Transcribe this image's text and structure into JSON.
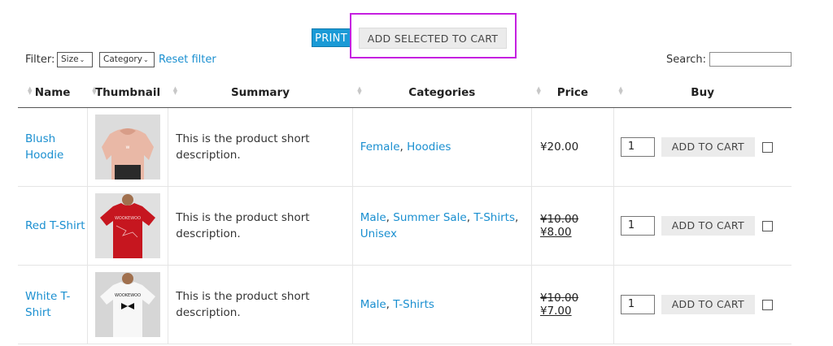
{
  "toolbar": {
    "print_label": "PRINT",
    "add_selected_label": "ADD SELECTED TO CART"
  },
  "filters": {
    "label": "Filter:",
    "size_select": "Size",
    "category_select": "Category",
    "reset_label": "Reset filter",
    "search_label": "Search:",
    "search_value": ""
  },
  "table": {
    "headers": [
      "Name",
      "Thumbnail",
      "Summary",
      "Categories",
      "Price",
      "Buy"
    ],
    "rows": [
      {
        "name_line1": "Blush",
        "name_line2": "Hoodie",
        "summary_line1": "This is the product short",
        "summary_line2": "description.",
        "categories": [
          "Female",
          "Hoodies"
        ],
        "price": "¥20.00",
        "qty": "1",
        "cart_label": "ADD TO CART",
        "thumb_color": "#e9b8a6"
      },
      {
        "name_line1": "Red T-Shirt",
        "name_line2": "",
        "summary_line1": "This is the product short",
        "summary_line2": "description.",
        "categories": [
          "Male",
          "Summer Sale",
          "T-Shirts",
          "Unisex"
        ],
        "price_old": "¥10.00",
        "price_new": "¥8.00",
        "qty": "1",
        "cart_label": "ADD TO CART",
        "thumb_color": "#c6161f"
      },
      {
        "name_line1": "White T-",
        "name_line2": "Shirt",
        "summary_line1": "This is the product short",
        "summary_line2": "description.",
        "categories": [
          "Male",
          "T-Shirts"
        ],
        "price_old": "¥10.00",
        "price_new": "¥7.00",
        "qty": "1",
        "cart_label": "ADD TO CART",
        "thumb_color": "#f2f2f2"
      }
    ]
  },
  "colors": {
    "link": "#1a8fd0",
    "print_button": "#1a9ad6",
    "highlight": "#c51fe0"
  }
}
